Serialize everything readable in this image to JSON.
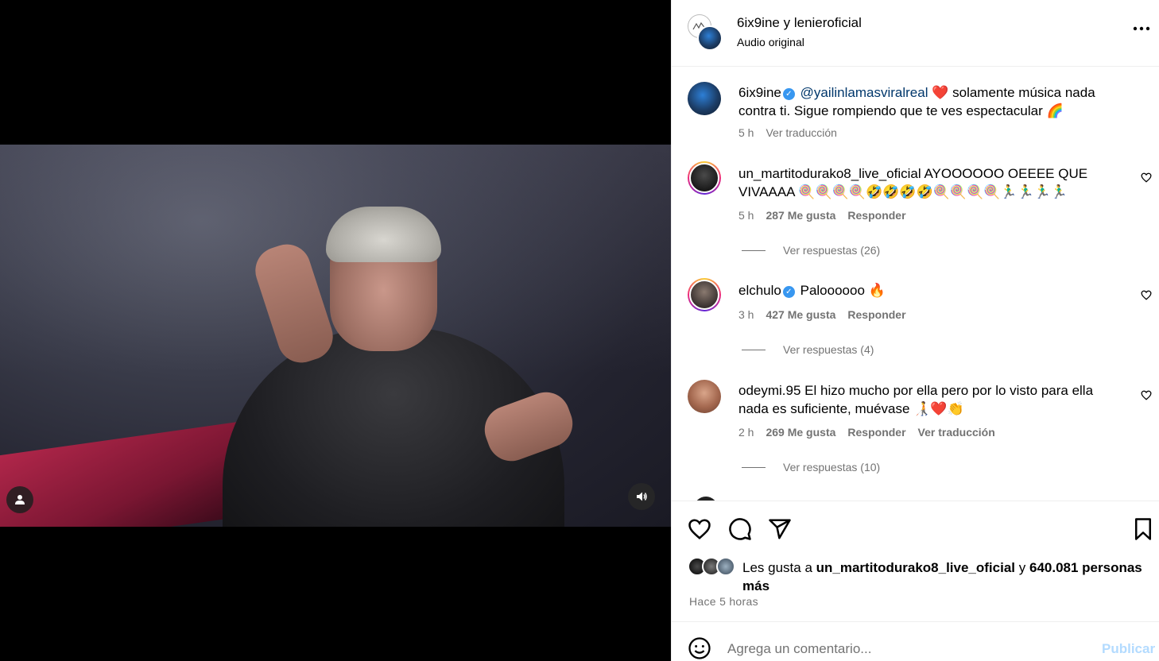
{
  "header": {
    "user1": "6ix9ine",
    "joiner": "y",
    "user2": "lenieroficial",
    "subtitle": "Audio original"
  },
  "caption": {
    "username": "6ix9ine",
    "mention": "@yailinlamasviralreal",
    "text_emoji1": "❤️",
    "text": "solamente música nada contra ti. Sigue rompiendo que te ves espectacular",
    "text_emoji2": "🌈",
    "time": "5 h",
    "translate": "Ver traducción"
  },
  "comments": [
    {
      "username": "un_martitodurako8_live_oficial",
      "text": "AYOOOOOO OEEEE QUE VIVAAAA 🍭🍭🍭🍭🤣🤣🤣🤣🍭🍭🍭🍭🏃‍♂️🏃‍♂️🏃‍♂️🏃‍♂️",
      "time": "5 h",
      "likes": "287 Me gusta",
      "reply": "Responder",
      "replies": "Ver respuestas (26)"
    },
    {
      "username": "elchulo",
      "text": "Paloooooo 🔥",
      "time": "3 h",
      "likes": "427 Me gusta",
      "reply": "Responder",
      "replies": "Ver respuestas (4)"
    },
    {
      "username": "odeymi.95",
      "text": "El hizo mucho por ella pero por lo visto para ella nada es suficiente, muévase 🧑‍🦯❤️👏",
      "time": "2 h",
      "likes": "269 Me gusta",
      "reply": "Responder",
      "translate": "Ver traducción",
      "replies": "Ver respuestas (10)"
    }
  ],
  "likes": {
    "prefix": "Les gusta a",
    "user": "un_martitodurako8_live_oficial",
    "joiner": "y",
    "count": "640.081 personas más"
  },
  "time_ago": "Hace 5 horas",
  "add_comment": {
    "placeholder": "Agrega un comentario...",
    "publish": "Publicar"
  },
  "icons": {
    "like": "heart-icon",
    "comment": "comment-icon",
    "share": "send-icon",
    "save": "bookmark-icon",
    "emoji": "emoji-icon",
    "more": "more-icon",
    "mute": "speaker-icon",
    "tagged": "user-icon"
  }
}
